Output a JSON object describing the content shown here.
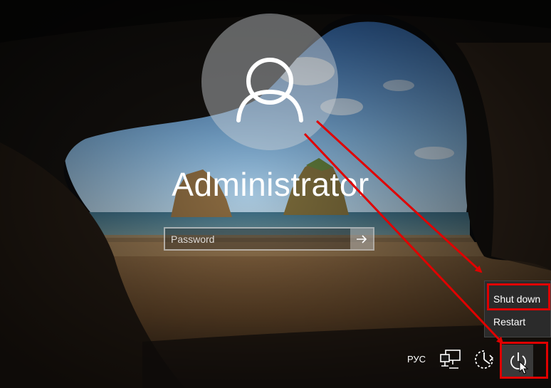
{
  "user": {
    "name": "Administrator"
  },
  "login": {
    "password_placeholder": "Password"
  },
  "power_menu": {
    "items": [
      {
        "label": "Shut down",
        "highlighted": true
      },
      {
        "label": "Restart",
        "highlighted": false
      }
    ]
  },
  "tray": {
    "language": "РУС",
    "icons": [
      "network-icon",
      "ease-of-access-icon",
      "power-icon"
    ]
  },
  "colors": {
    "highlight": "#e00000",
    "menu_bg": "#2b2b2b",
    "arrow": "#e00000"
  }
}
